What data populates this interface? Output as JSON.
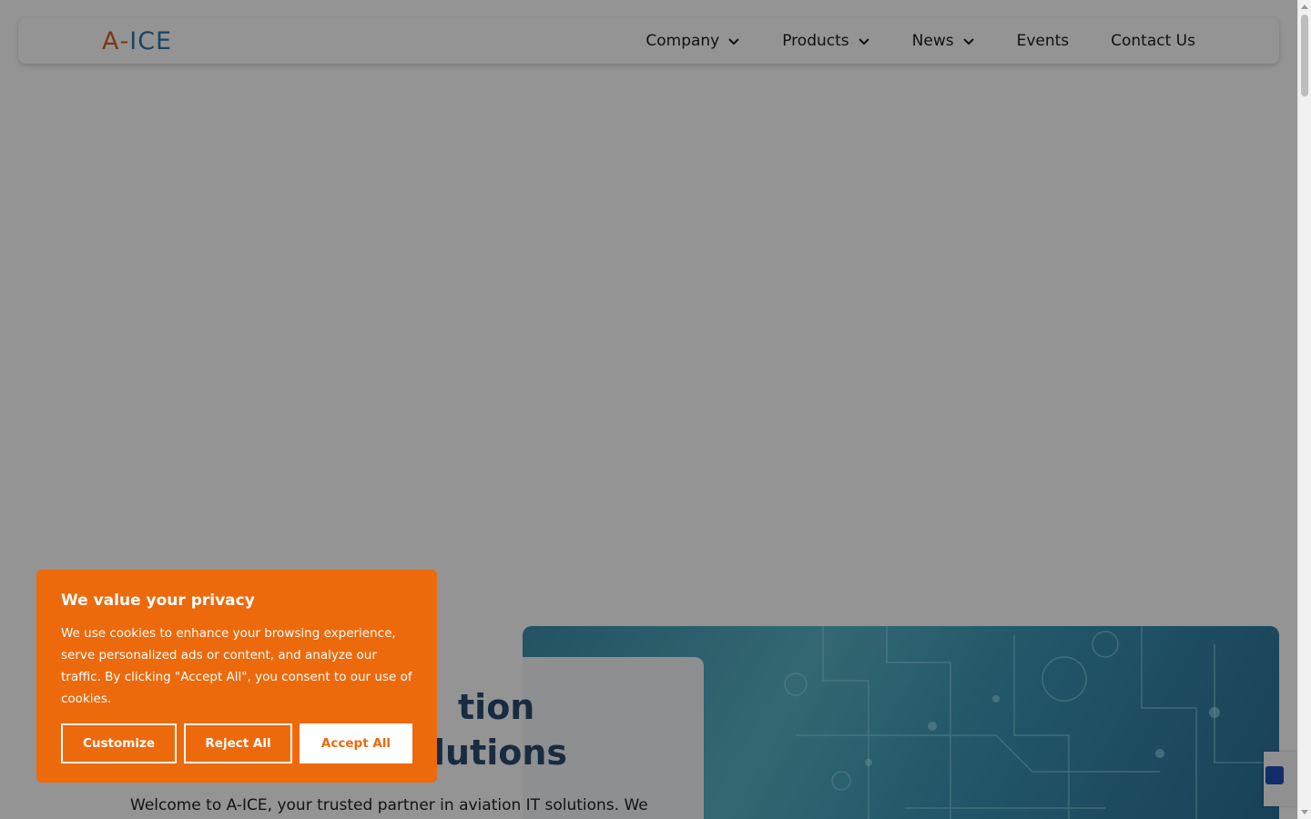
{
  "brand": {
    "logo_a": "A",
    "logo_dash": "-",
    "logo_ice": "ICE",
    "colors": {
      "orange": "#ec6a0c",
      "blue": "#2f78a8"
    }
  },
  "nav": {
    "items": [
      {
        "label": "Company",
        "dropdown": true
      },
      {
        "label": "Products",
        "dropdown": true
      },
      {
        "label": "News",
        "dropdown": true
      },
      {
        "label": "Events",
        "dropdown": false
      },
      {
        "label": "Contact Us",
        "dropdown": false
      }
    ]
  },
  "hero": {
    "title_line1": "tion",
    "title_line2": "lutions",
    "text": "Welcome to A-ICE, your trusted partner in aviation IT solutions. We"
  },
  "cookie": {
    "title": "We value your privacy",
    "text": "We use cookies to enhance your browsing experience, serve personalized ads or content, and analyze our traffic. By clicking \"Accept All\", you consent to our use of cookies.",
    "customize_label": "Customize",
    "reject_label": "Reject All",
    "accept_label": "Accept All"
  }
}
